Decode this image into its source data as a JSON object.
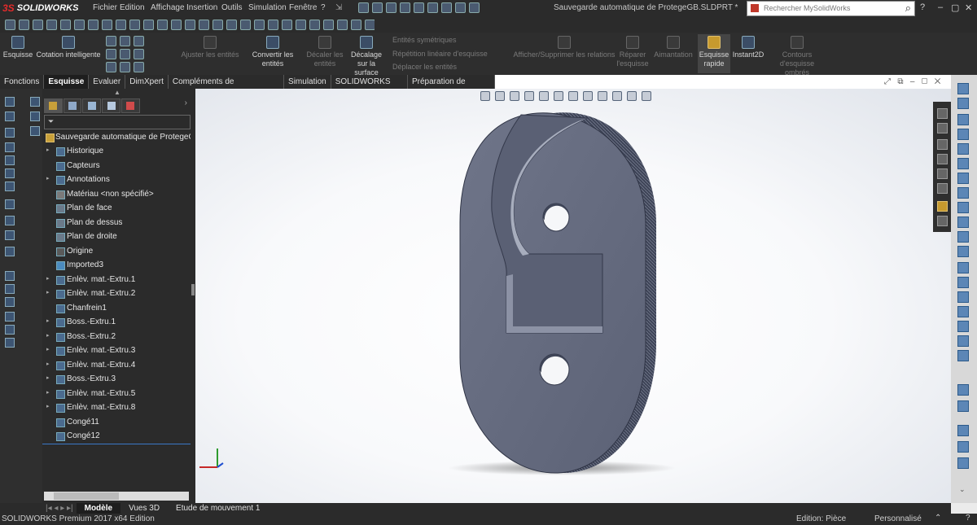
{
  "app": {
    "logo": "SOLIDWORKS",
    "doc_title": "Sauvegarde automatique de ProtegeGB.SLDPRT *",
    "menus": [
      "Fichier",
      "Edition",
      "Affichage",
      "Insertion",
      "Outils",
      "Simulation",
      "Fenêtre",
      "?"
    ],
    "search_placeholder": "Rechercher MySolidWorks"
  },
  "command_manager": {
    "buttons": [
      {
        "label": "Esquisse",
        "state": "normal"
      },
      {
        "label": "Cotation intelligente",
        "state": "normal"
      },
      {
        "label": "Ajuster les entités",
        "state": "dim"
      },
      {
        "label": "Convertir les entités",
        "state": "normal"
      },
      {
        "label": "Décaler les entités",
        "state": "dim"
      },
      {
        "label": "Décalage sur la surface",
        "state": "normal"
      },
      {
        "label": "Entités symétriques",
        "state": "dim"
      },
      {
        "label": "Répétition linéaire d'esquisse",
        "state": "dim"
      },
      {
        "label": "Déplacer les entités",
        "state": "dim"
      },
      {
        "label": "Afficher/Supprimer les relations",
        "state": "dim"
      },
      {
        "label": "Réparer l'esquisse",
        "state": "dim"
      },
      {
        "label": "Aimantation",
        "state": "dim"
      },
      {
        "label": "Esquisse rapide",
        "state": "active"
      },
      {
        "label": "Instant2D",
        "state": "normal"
      },
      {
        "label": "Contours d'esquisse ombrés",
        "state": "dim"
      }
    ]
  },
  "tabs": [
    "Fonctions",
    "Esquisse",
    "Evaluer",
    "DimXpert",
    "Compléments de SOLIDWORKS",
    "Simulation",
    "SOLIDWORKS MBD",
    "Préparation de l'analyse"
  ],
  "selected_tab": "Esquisse",
  "tree": {
    "root": "Sauvegarde automatique de ProtegeGB",
    "items": [
      {
        "label": "Historique",
        "expandable": true
      },
      {
        "label": "Capteurs",
        "expandable": false
      },
      {
        "label": "Annotations",
        "expandable": true
      },
      {
        "label": "Matériau <non spécifié>",
        "expandable": false
      },
      {
        "label": "Plan de face",
        "expandable": false
      },
      {
        "label": "Plan de dessus",
        "expandable": false
      },
      {
        "label": "Plan de droite",
        "expandable": false
      },
      {
        "label": "Origine",
        "expandable": false
      },
      {
        "label": "Imported3",
        "expandable": false
      },
      {
        "label": "Enlèv. mat.-Extru.1",
        "expandable": true
      },
      {
        "label": "Enlèv. mat.-Extru.2",
        "expandable": true
      },
      {
        "label": "Chanfrein1",
        "expandable": false
      },
      {
        "label": "Boss.-Extru.1",
        "expandable": true
      },
      {
        "label": "Boss.-Extru.2",
        "expandable": true
      },
      {
        "label": "Enlèv. mat.-Extru.3",
        "expandable": true
      },
      {
        "label": "Enlèv. mat.-Extru.4",
        "expandable": true
      },
      {
        "label": "Boss.-Extru.3",
        "expandable": true
      },
      {
        "label": "Enlèv. mat.-Extru.5",
        "expandable": true
      },
      {
        "label": "Enlèv. mat.-Extru.8",
        "expandable": true
      },
      {
        "label": "Congé11",
        "expandable": false
      },
      {
        "label": "Congé12",
        "expandable": false
      }
    ]
  },
  "bottom_tabs": [
    "Modèle",
    "Vues 3D",
    "Etude de mouvement 1"
  ],
  "selected_bottom_tab": "Modèle",
  "status": {
    "edition": "SOLIDWORKS Premium 2017 x64 Edition",
    "mode": "Edition: Pièce",
    "custom": "Personnalisé"
  },
  "colors": {
    "part": "#6c7287",
    "part_dark": "#4a5064",
    "accent_red": "#e32b2b"
  }
}
